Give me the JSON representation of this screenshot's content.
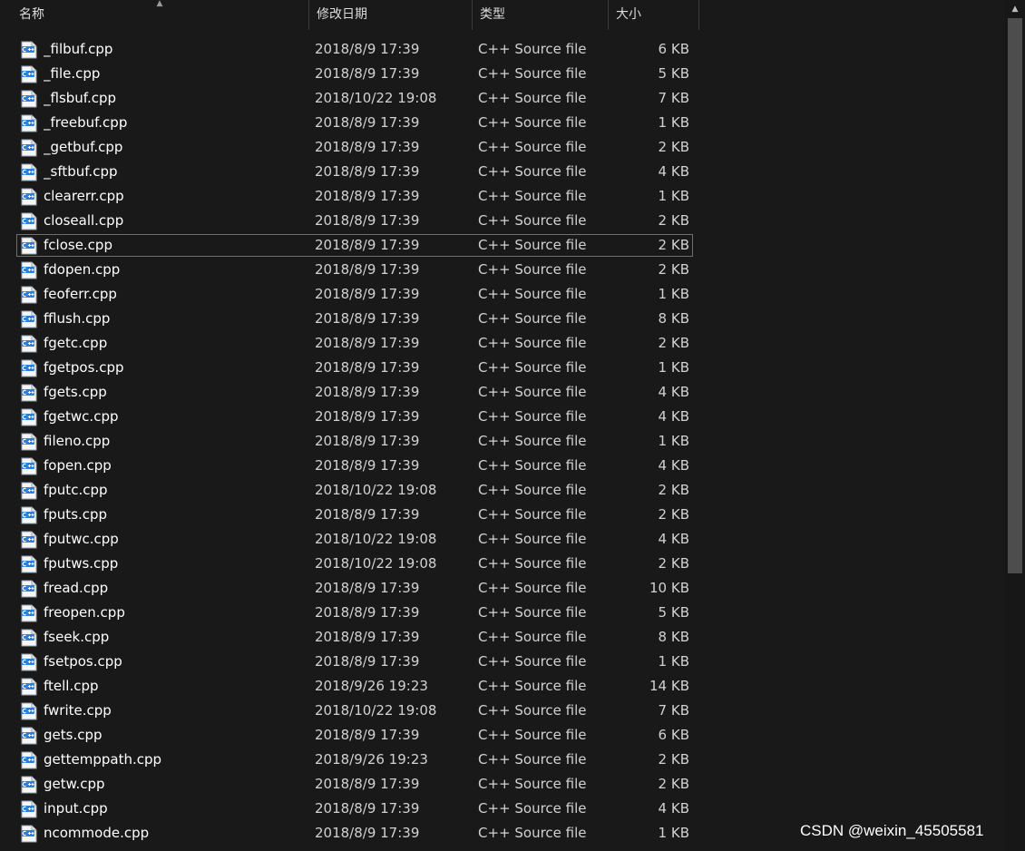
{
  "colors": {
    "background": "#191919",
    "text_primary": "#ffffff",
    "text_secondary": "#d2d2d2",
    "icon_accent": "#2f7fd6"
  },
  "header": {
    "name": "名称",
    "date": "修改日期",
    "type": "类型",
    "size": "大小",
    "sort_icon": "sort-ascending-caret"
  },
  "files": [
    {
      "name": "_filbuf.cpp",
      "date": "2018/8/9 17:39",
      "type": "C++ Source file",
      "size": "6 KB"
    },
    {
      "name": "_file.cpp",
      "date": "2018/8/9 17:39",
      "type": "C++ Source file",
      "size": "5 KB"
    },
    {
      "name": "_flsbuf.cpp",
      "date": "2018/10/22 19:08",
      "type": "C++ Source file",
      "size": "7 KB"
    },
    {
      "name": "_freebuf.cpp",
      "date": "2018/8/9 17:39",
      "type": "C++ Source file",
      "size": "1 KB"
    },
    {
      "name": "_getbuf.cpp",
      "date": "2018/8/9 17:39",
      "type": "C++ Source file",
      "size": "2 KB"
    },
    {
      "name": "_sftbuf.cpp",
      "date": "2018/8/9 17:39",
      "type": "C++ Source file",
      "size": "4 KB"
    },
    {
      "name": "clearerr.cpp",
      "date": "2018/8/9 17:39",
      "type": "C++ Source file",
      "size": "1 KB"
    },
    {
      "name": "closeall.cpp",
      "date": "2018/8/9 17:39",
      "type": "C++ Source file",
      "size": "2 KB"
    },
    {
      "name": "fclose.cpp",
      "date": "2018/8/9 17:39",
      "type": "C++ Source file",
      "size": "2 KB"
    },
    {
      "name": "fdopen.cpp",
      "date": "2018/8/9 17:39",
      "type": "C++ Source file",
      "size": "2 KB"
    },
    {
      "name": "feoferr.cpp",
      "date": "2018/8/9 17:39",
      "type": "C++ Source file",
      "size": "1 KB"
    },
    {
      "name": "fflush.cpp",
      "date": "2018/8/9 17:39",
      "type": "C++ Source file",
      "size": "8 KB"
    },
    {
      "name": "fgetc.cpp",
      "date": "2018/8/9 17:39",
      "type": "C++ Source file",
      "size": "2 KB"
    },
    {
      "name": "fgetpos.cpp",
      "date": "2018/8/9 17:39",
      "type": "C++ Source file",
      "size": "1 KB"
    },
    {
      "name": "fgets.cpp",
      "date": "2018/8/9 17:39",
      "type": "C++ Source file",
      "size": "4 KB"
    },
    {
      "name": "fgetwc.cpp",
      "date": "2018/8/9 17:39",
      "type": "C++ Source file",
      "size": "4 KB"
    },
    {
      "name": "fileno.cpp",
      "date": "2018/8/9 17:39",
      "type": "C++ Source file",
      "size": "1 KB"
    },
    {
      "name": "fopen.cpp",
      "date": "2018/8/9 17:39",
      "type": "C++ Source file",
      "size": "4 KB"
    },
    {
      "name": "fputc.cpp",
      "date": "2018/10/22 19:08",
      "type": "C++ Source file",
      "size": "2 KB"
    },
    {
      "name": "fputs.cpp",
      "date": "2018/8/9 17:39",
      "type": "C++ Source file",
      "size": "2 KB"
    },
    {
      "name": "fputwc.cpp",
      "date": "2018/10/22 19:08",
      "type": "C++ Source file",
      "size": "4 KB"
    },
    {
      "name": "fputws.cpp",
      "date": "2018/10/22 19:08",
      "type": "C++ Source file",
      "size": "2 KB"
    },
    {
      "name": "fread.cpp",
      "date": "2018/8/9 17:39",
      "type": "C++ Source file",
      "size": "10 KB"
    },
    {
      "name": "freopen.cpp",
      "date": "2018/8/9 17:39",
      "type": "C++ Source file",
      "size": "5 KB"
    },
    {
      "name": "fseek.cpp",
      "date": "2018/8/9 17:39",
      "type": "C++ Source file",
      "size": "8 KB"
    },
    {
      "name": "fsetpos.cpp",
      "date": "2018/8/9 17:39",
      "type": "C++ Source file",
      "size": "1 KB"
    },
    {
      "name": "ftell.cpp",
      "date": "2018/9/26 19:23",
      "type": "C++ Source file",
      "size": "14 KB"
    },
    {
      "name": "fwrite.cpp",
      "date": "2018/10/22 19:08",
      "type": "C++ Source file",
      "size": "7 KB"
    },
    {
      "name": "gets.cpp",
      "date": "2018/8/9 17:39",
      "type": "C++ Source file",
      "size": "6 KB"
    },
    {
      "name": "gettemppath.cpp",
      "date": "2018/9/26 19:23",
      "type": "C++ Source file",
      "size": "2 KB"
    },
    {
      "name": "getw.cpp",
      "date": "2018/8/9 17:39",
      "type": "C++ Source file",
      "size": "2 KB"
    },
    {
      "name": "input.cpp",
      "date": "2018/8/9 17:39",
      "type": "C++ Source file",
      "size": "4 KB"
    },
    {
      "name": "ncommode.cpp",
      "date": "2018/8/9 17:39",
      "type": "C++ Source file",
      "size": "1 KB"
    }
  ],
  "focused_file": "fclose.cpp",
  "file_icon": "cpp-source-file-icon",
  "scrollbar": {
    "up_icon": "scroll-up-arrow-icon"
  },
  "watermark": "CSDN @weixin_45505581"
}
